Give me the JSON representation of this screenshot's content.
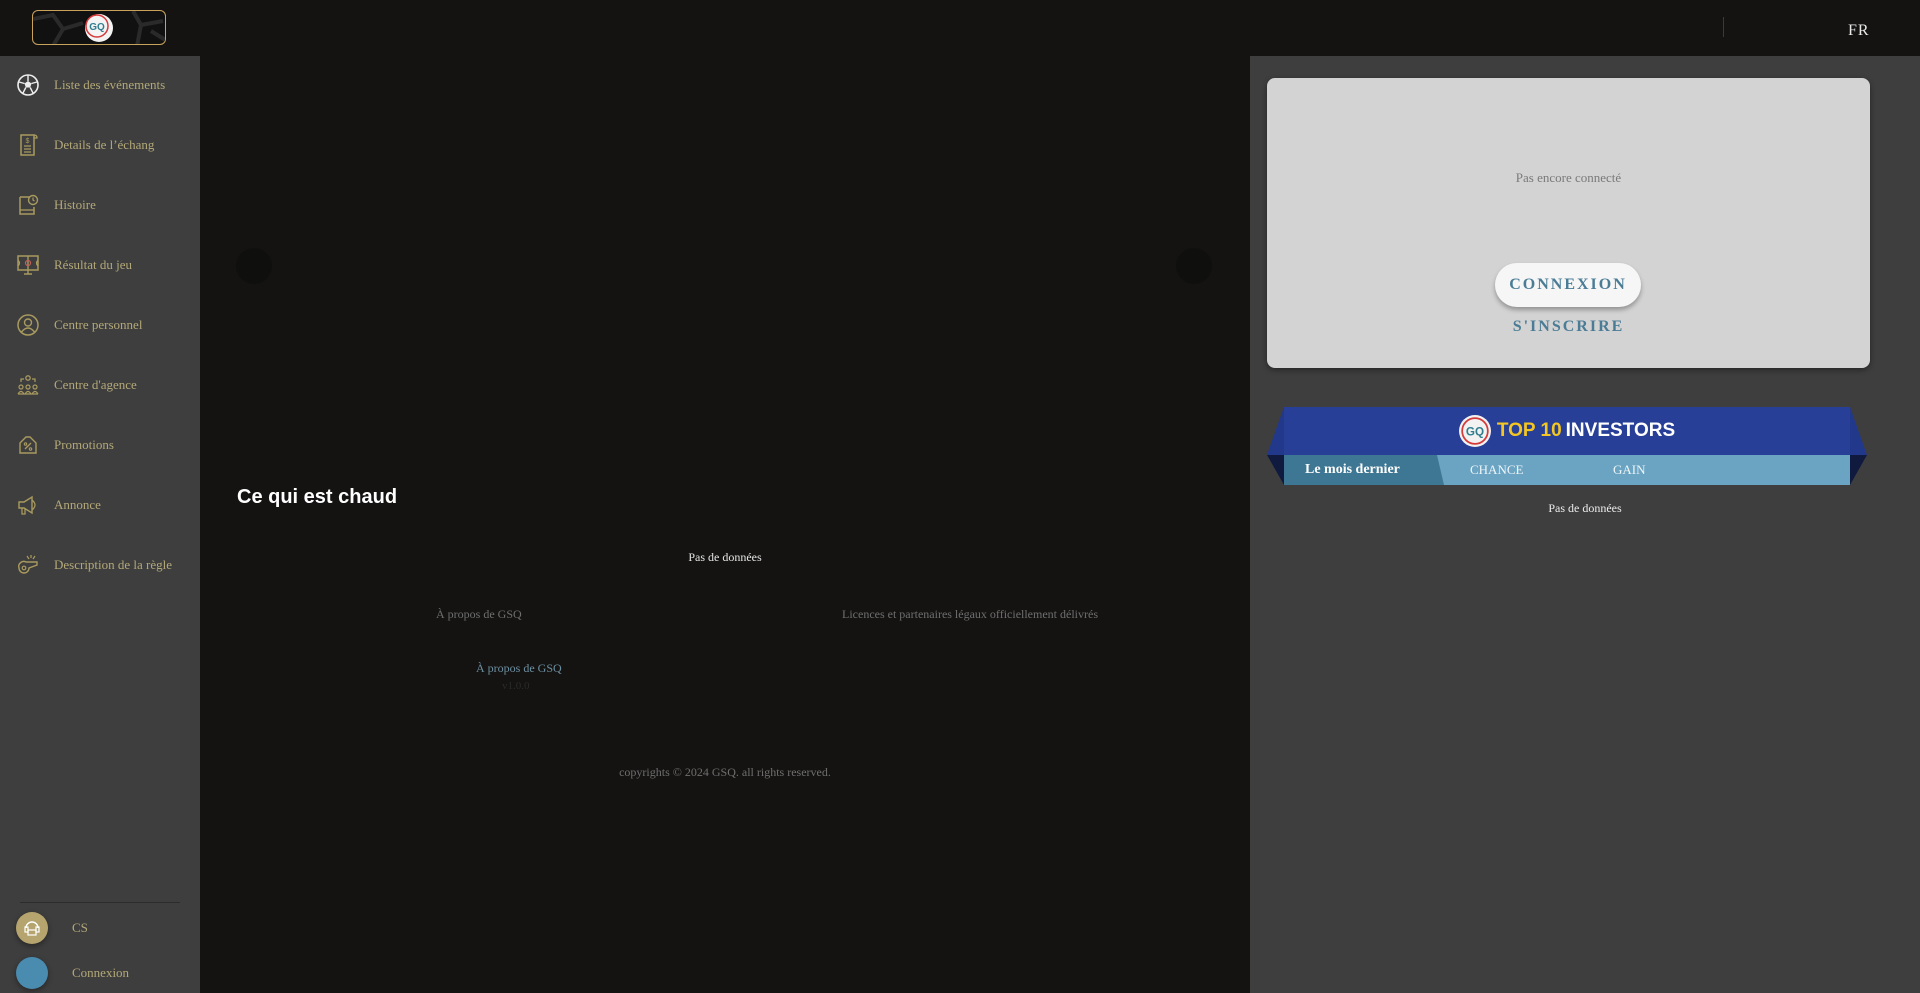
{
  "header": {
    "logo_alt": "GSQ",
    "language": "FR"
  },
  "sidebar": {
    "items": [
      {
        "label": "Liste des événements",
        "icon": "soccer-ball-icon"
      },
      {
        "label": "Details de l’échang",
        "icon": "receipt-icon"
      },
      {
        "label": "Histoire",
        "icon": "history-book-icon"
      },
      {
        "label": "Résultat du jeu",
        "icon": "game-result-monitor-icon"
      },
      {
        "label": "Centre personnel",
        "icon": "user-circle-icon"
      },
      {
        "label": "Centre d'agence",
        "icon": "agency-group-icon"
      },
      {
        "label": "Promotions",
        "icon": "percent-tag-icon"
      },
      {
        "label": "Annonce",
        "icon": "megaphone-icon"
      },
      {
        "label": "Description de la règle",
        "icon": "whistle-icon"
      }
    ],
    "bottom": [
      {
        "label": "CS",
        "icon": "customer-service-icon",
        "color": "#b5a46e"
      },
      {
        "label": "Connexion",
        "icon": "login-avatar-icon",
        "color": "#4a8bb0"
      }
    ]
  },
  "main": {
    "hot_title": "Ce qui est chaud",
    "no_data": "Pas de données",
    "footer": {
      "about_heading": "À propos de GSQ",
      "licenses_heading": "Licences et partenaires légaux officiellement délivrés",
      "about_link": "À propos de GSQ",
      "version": "v1.0.0",
      "copyright": "copyrights © 2024 GSQ. all rights reserved."
    }
  },
  "right_panel": {
    "login_card": {
      "status": "Pas encore connecté",
      "login_button": "CONNEXION",
      "register_button": "S'INSCRIRE"
    },
    "top10": {
      "title_highlight": "TOP 10",
      "title_rest": "INVESTORS",
      "tabs": [
        {
          "label": "Le mois dernier",
          "active": true
        },
        {
          "label": "CHANCE",
          "active": false
        },
        {
          "label": "GAIN",
          "active": false
        }
      ],
      "no_data": "Pas de données"
    }
  },
  "colors": {
    "gold_accent": "#c9a35b",
    "sidebar_text": "#b3a878",
    "brand_blue": "#273f97",
    "tab_blue": "#6aa4c2",
    "tab_active": "#3d7794",
    "link_blue": "#4b7c96",
    "yellow": "#f3c623"
  }
}
